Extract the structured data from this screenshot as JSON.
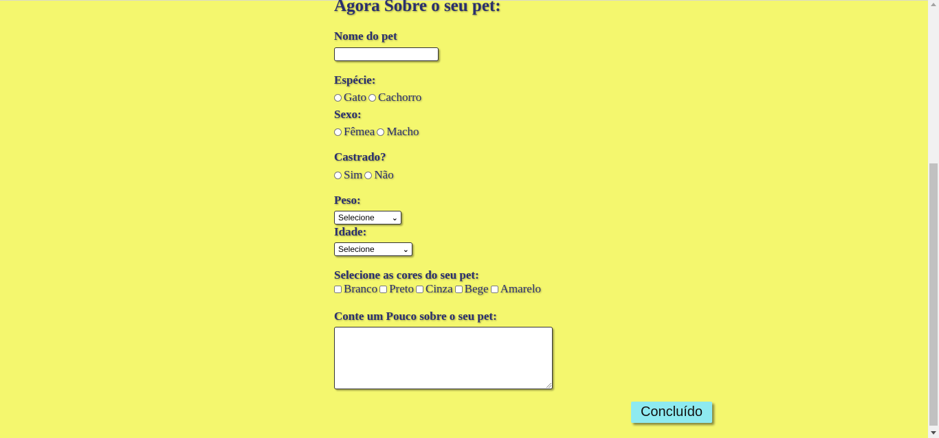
{
  "form": {
    "title": "Agora Sobre o seu pet:",
    "pet_name": {
      "label": "Nome do pet",
      "value": ""
    },
    "species": {
      "label": "Espécie:",
      "options": [
        "Gato",
        "Cachorro"
      ]
    },
    "sex": {
      "label": "Sexo:",
      "options": [
        "Fêmea",
        "Macho"
      ]
    },
    "neutered": {
      "label": "Castrado?",
      "options": [
        "Sim",
        "Não"
      ]
    },
    "weight": {
      "label": "Peso:",
      "selected": "Selecione"
    },
    "age": {
      "label": "Idade:",
      "selected": "Selecione"
    },
    "colors": {
      "label": "Selecione as cores do seu pet:",
      "options": [
        "Branco",
        "Preto",
        "Cinza",
        "Bege",
        "Amarelo"
      ]
    },
    "about": {
      "label": "Conte um Pouco sobre o seu pet:",
      "value": ""
    },
    "submit_label": "Concluído"
  },
  "colors": {
    "background": "#f4f76e",
    "text": "#2a2f6e",
    "button": "#8eeaf0"
  },
  "icons": {
    "select_arrow": "chevron-down-icon",
    "scroll_up": "scroll-up-arrow-icon",
    "scroll_down": "scroll-down-arrow-icon"
  }
}
